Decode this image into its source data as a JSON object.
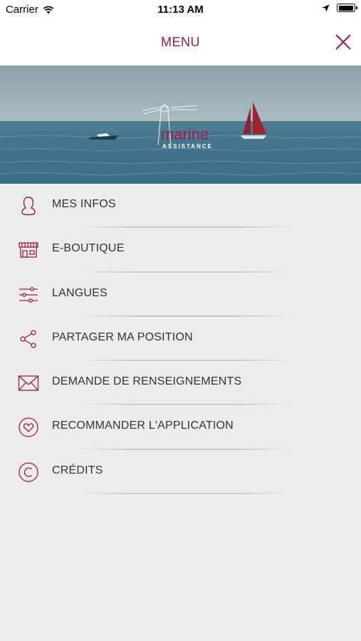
{
  "status_bar": {
    "carrier": "Carrier",
    "time": "11:13 AM"
  },
  "header": {
    "title": "MENU",
    "accent_color": "#9b1b4a"
  },
  "banner": {
    "logo_text": "marine",
    "logo_subtext": "ASSISTANCE"
  },
  "menu": {
    "items": [
      {
        "label": "MES INFOS",
        "icon": "user-icon"
      },
      {
        "label": "E-BOUTIQUE",
        "icon": "shop-icon"
      },
      {
        "label": "LANGUES",
        "icon": "sliders-icon"
      },
      {
        "label": "PARTAGER MA POSITION",
        "icon": "share-icon"
      },
      {
        "label": "DEMANDE DE RENSEIGNEMENTS",
        "icon": "envelope-icon"
      },
      {
        "label": "RECOMMANDER L'APPLICATION",
        "icon": "heart-icon"
      },
      {
        "label": "CRÉDITS",
        "icon": "copyright-icon"
      }
    ]
  }
}
